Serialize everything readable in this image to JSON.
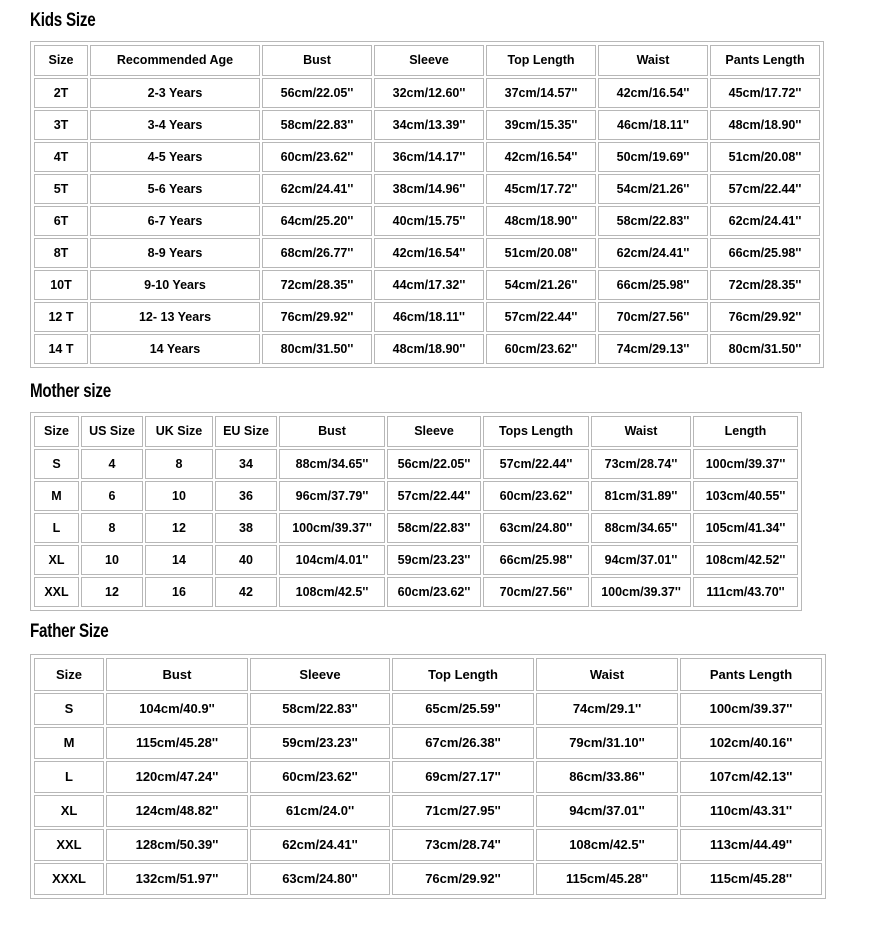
{
  "sections": [
    {
      "id": "kids",
      "title": "Kids Size",
      "headers": [
        "Size",
        "Recommended Age",
        "Bust",
        "Sleeve",
        "Top Length",
        "Waist",
        "Pants Length"
      ],
      "rows": [
        [
          "2T",
          "2-3 Years",
          "56cm/22.05''",
          "32cm/12.60''",
          "37cm/14.57''",
          "42cm/16.54''",
          "45cm/17.72''"
        ],
        [
          "3T",
          "3-4 Years",
          "58cm/22.83''",
          "34cm/13.39''",
          "39cm/15.35''",
          "46cm/18.11''",
          "48cm/18.90''"
        ],
        [
          "4T",
          "4-5 Years",
          "60cm/23.62''",
          "36cm/14.17''",
          "42cm/16.54''",
          "50cm/19.69''",
          "51cm/20.08''"
        ],
        [
          "5T",
          "5-6 Years",
          "62cm/24.41''",
          "38cm/14.96''",
          "45cm/17.72''",
          "54cm/21.26''",
          "57cm/22.44''"
        ],
        [
          "6T",
          "6-7 Years",
          "64cm/25.20''",
          "40cm/15.75''",
          "48cm/18.90''",
          "58cm/22.83''",
          "62cm/24.41''"
        ],
        [
          "8T",
          "8-9 Years",
          "68cm/26.77''",
          "42cm/16.54''",
          "51cm/20.08''",
          "62cm/24.41''",
          "66cm/25.98''"
        ],
        [
          "10T",
          "9-10 Years",
          "72cm/28.35''",
          "44cm/17.32''",
          "54cm/21.26''",
          "66cm/25.98''",
          "72cm/28.35''"
        ],
        [
          "12 T",
          "12- 13 Years",
          "76cm/29.92''",
          "46cm/18.11''",
          "57cm/22.44''",
          "70cm/27.56''",
          "76cm/29.92''"
        ],
        [
          "14 T",
          "14  Years",
          "80cm/31.50''",
          "48cm/18.90''",
          "60cm/23.62''",
          "74cm/29.13''",
          "80cm/31.50''"
        ]
      ]
    },
    {
      "id": "mother",
      "title": "Mother size",
      "headers": [
        "Size",
        "US Size",
        "UK Size",
        "EU Size",
        "Bust",
        "Sleeve",
        "Tops Length",
        "Waist",
        "Length"
      ],
      "rows": [
        [
          "S",
          "4",
          "8",
          "34",
          "88cm/34.65''",
          "56cm/22.05''",
          "57cm/22.44''",
          "73cm/28.74''",
          "100cm/39.37''"
        ],
        [
          "M",
          "6",
          "10",
          "36",
          "96cm/37.79''",
          "57cm/22.44''",
          "60cm/23.62''",
          "81cm/31.89''",
          "103cm/40.55''"
        ],
        [
          "L",
          "8",
          "12",
          "38",
          "100cm/39.37''",
          "58cm/22.83''",
          "63cm/24.80''",
          "88cm/34.65''",
          "105cm/41.34''"
        ],
        [
          "XL",
          "10",
          "14",
          "40",
          "104cm/4.01''",
          "59cm/23.23''",
          "66cm/25.98''",
          "94cm/37.01''",
          "108cm/42.52''"
        ],
        [
          "XXL",
          "12",
          "16",
          "42",
          "108cm/42.5''",
          "60cm/23.62''",
          "70cm/27.56''",
          "100cm/39.37''",
          "111cm/43.70''"
        ]
      ]
    },
    {
      "id": "father",
      "title": "Father Size",
      "headers": [
        "Size",
        "Bust",
        "Sleeve",
        "Top Length",
        "Waist",
        "Pants Length"
      ],
      "rows": [
        [
          "S",
          "104cm/40.9''",
          "58cm/22.83''",
          "65cm/25.59''",
          "74cm/29.1''",
          "100cm/39.37''"
        ],
        [
          "M",
          "115cm/45.28''",
          "59cm/23.23''",
          "67cm/26.38''",
          "79cm/31.10''",
          "102cm/40.16''"
        ],
        [
          "L",
          "120cm/47.24''",
          "60cm/23.62''",
          "69cm/27.17''",
          "86cm/33.86''",
          "107cm/42.13''"
        ],
        [
          "XL",
          "124cm/48.82''",
          "61cm/24.0''",
          "71cm/27.95''",
          "94cm/37.01''",
          "110cm/43.31''"
        ],
        [
          "XXL",
          "128cm/50.39''",
          "62cm/24.41''",
          "73cm/28.74''",
          "108cm/42.5''",
          "113cm/44.49''"
        ],
        [
          "XXXL",
          "132cm/51.97''",
          "63cm/24.80''",
          "76cm/29.92''",
          "115cm/45.28''",
          "115cm/45.28''"
        ]
      ]
    }
  ],
  "column_widths": {
    "kids": [
      54,
      170,
      110,
      110,
      110,
      110,
      110
    ],
    "mother": [
      45,
      62,
      68,
      62,
      106,
      94,
      106,
      100,
      105
    ],
    "father": [
      70,
      142,
      140,
      142,
      142,
      142
    ]
  },
  "colors": {
    "text": "#000000",
    "cell_border": "#b7b7b7",
    "table_border": "#b8b8b8",
    "background": "#ffffff"
  }
}
